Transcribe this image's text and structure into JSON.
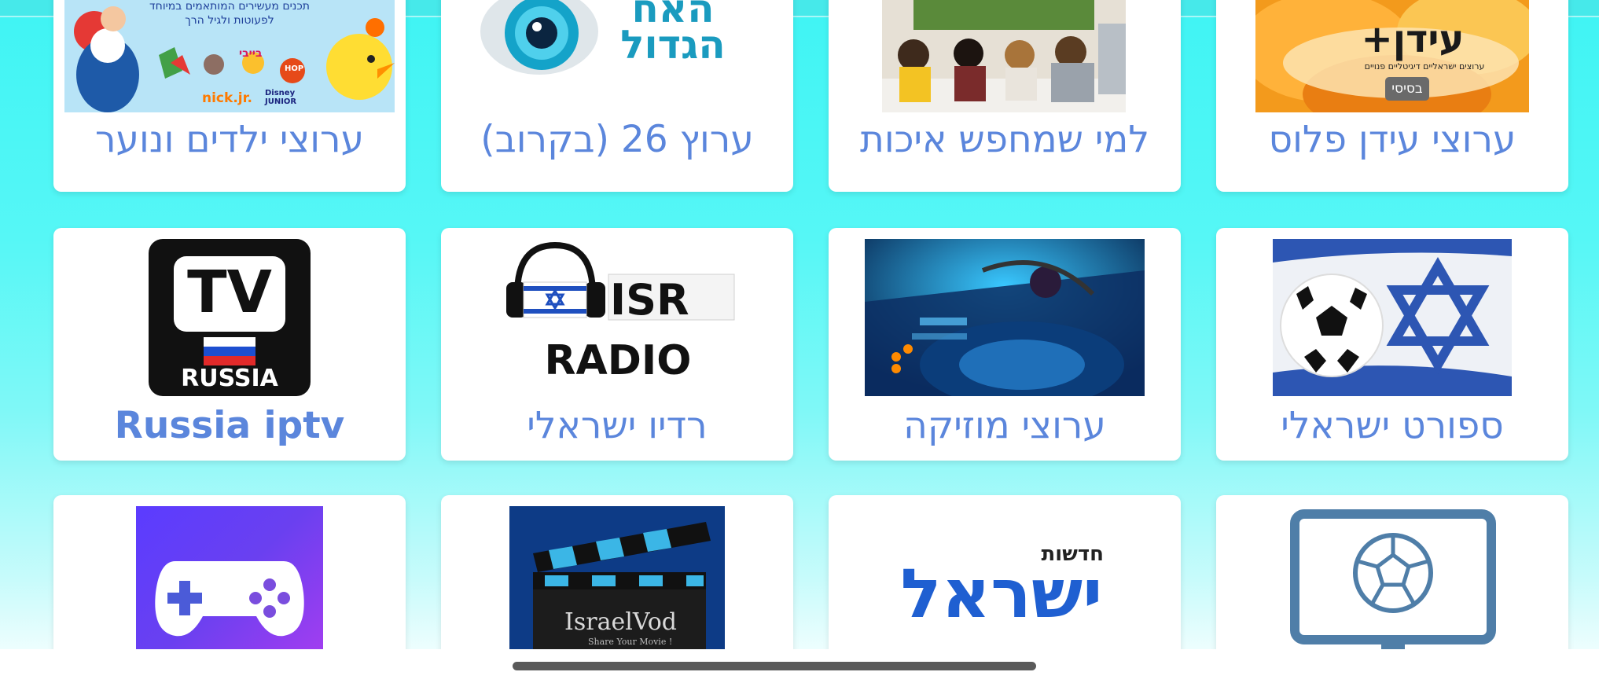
{
  "categories_row1": [
    {
      "label": "ערוצי ילדים ונוער"
    },
    {
      "label": "ערוץ 26 (בקרוב)"
    },
    {
      "label": "למי שמחפש איכות"
    },
    {
      "label": "ערוצי עידן פלוס"
    }
  ],
  "categories_row2": [
    {
      "label": "Russia iptv"
    },
    {
      "label": "רדיו ישראלי"
    },
    {
      "label": "ערוצי מוזיקה"
    },
    {
      "label": "ספורט ישראלי"
    }
  ],
  "thumbs": {
    "kids_text_1": "תכנים מעשירים המותאמים במיוחד",
    "kids_text_2": "לפעוטות ולגיל הרך",
    "kids_logo_1": "בייבי",
    "kids_logo_2": "nick.jr.",
    "kids_logo_3": "Disney JUNIOR",
    "kids_logo_4": "HOP",
    "bigbrother_1": "האח",
    "bigbrother_2": "הגדול",
    "idan_title": "עידן+",
    "idan_sub": "ערוצים ישראליים דיגיטליים פנויים",
    "idan_badge": "בסיסי",
    "tv_russia_top": "TV",
    "tv_russia_bottom": "RUSSIA",
    "isr": "ISR",
    "radio": "RADIO",
    "israelvod": "IsraelVod",
    "israelvod_sub": "Share Your Movie !",
    "news_small": "חדשות",
    "news_big": "ישראל"
  },
  "colors": {
    "label": "#5b86dc",
    "background_top": "#3ff4f4",
    "card": "#ffffff"
  }
}
